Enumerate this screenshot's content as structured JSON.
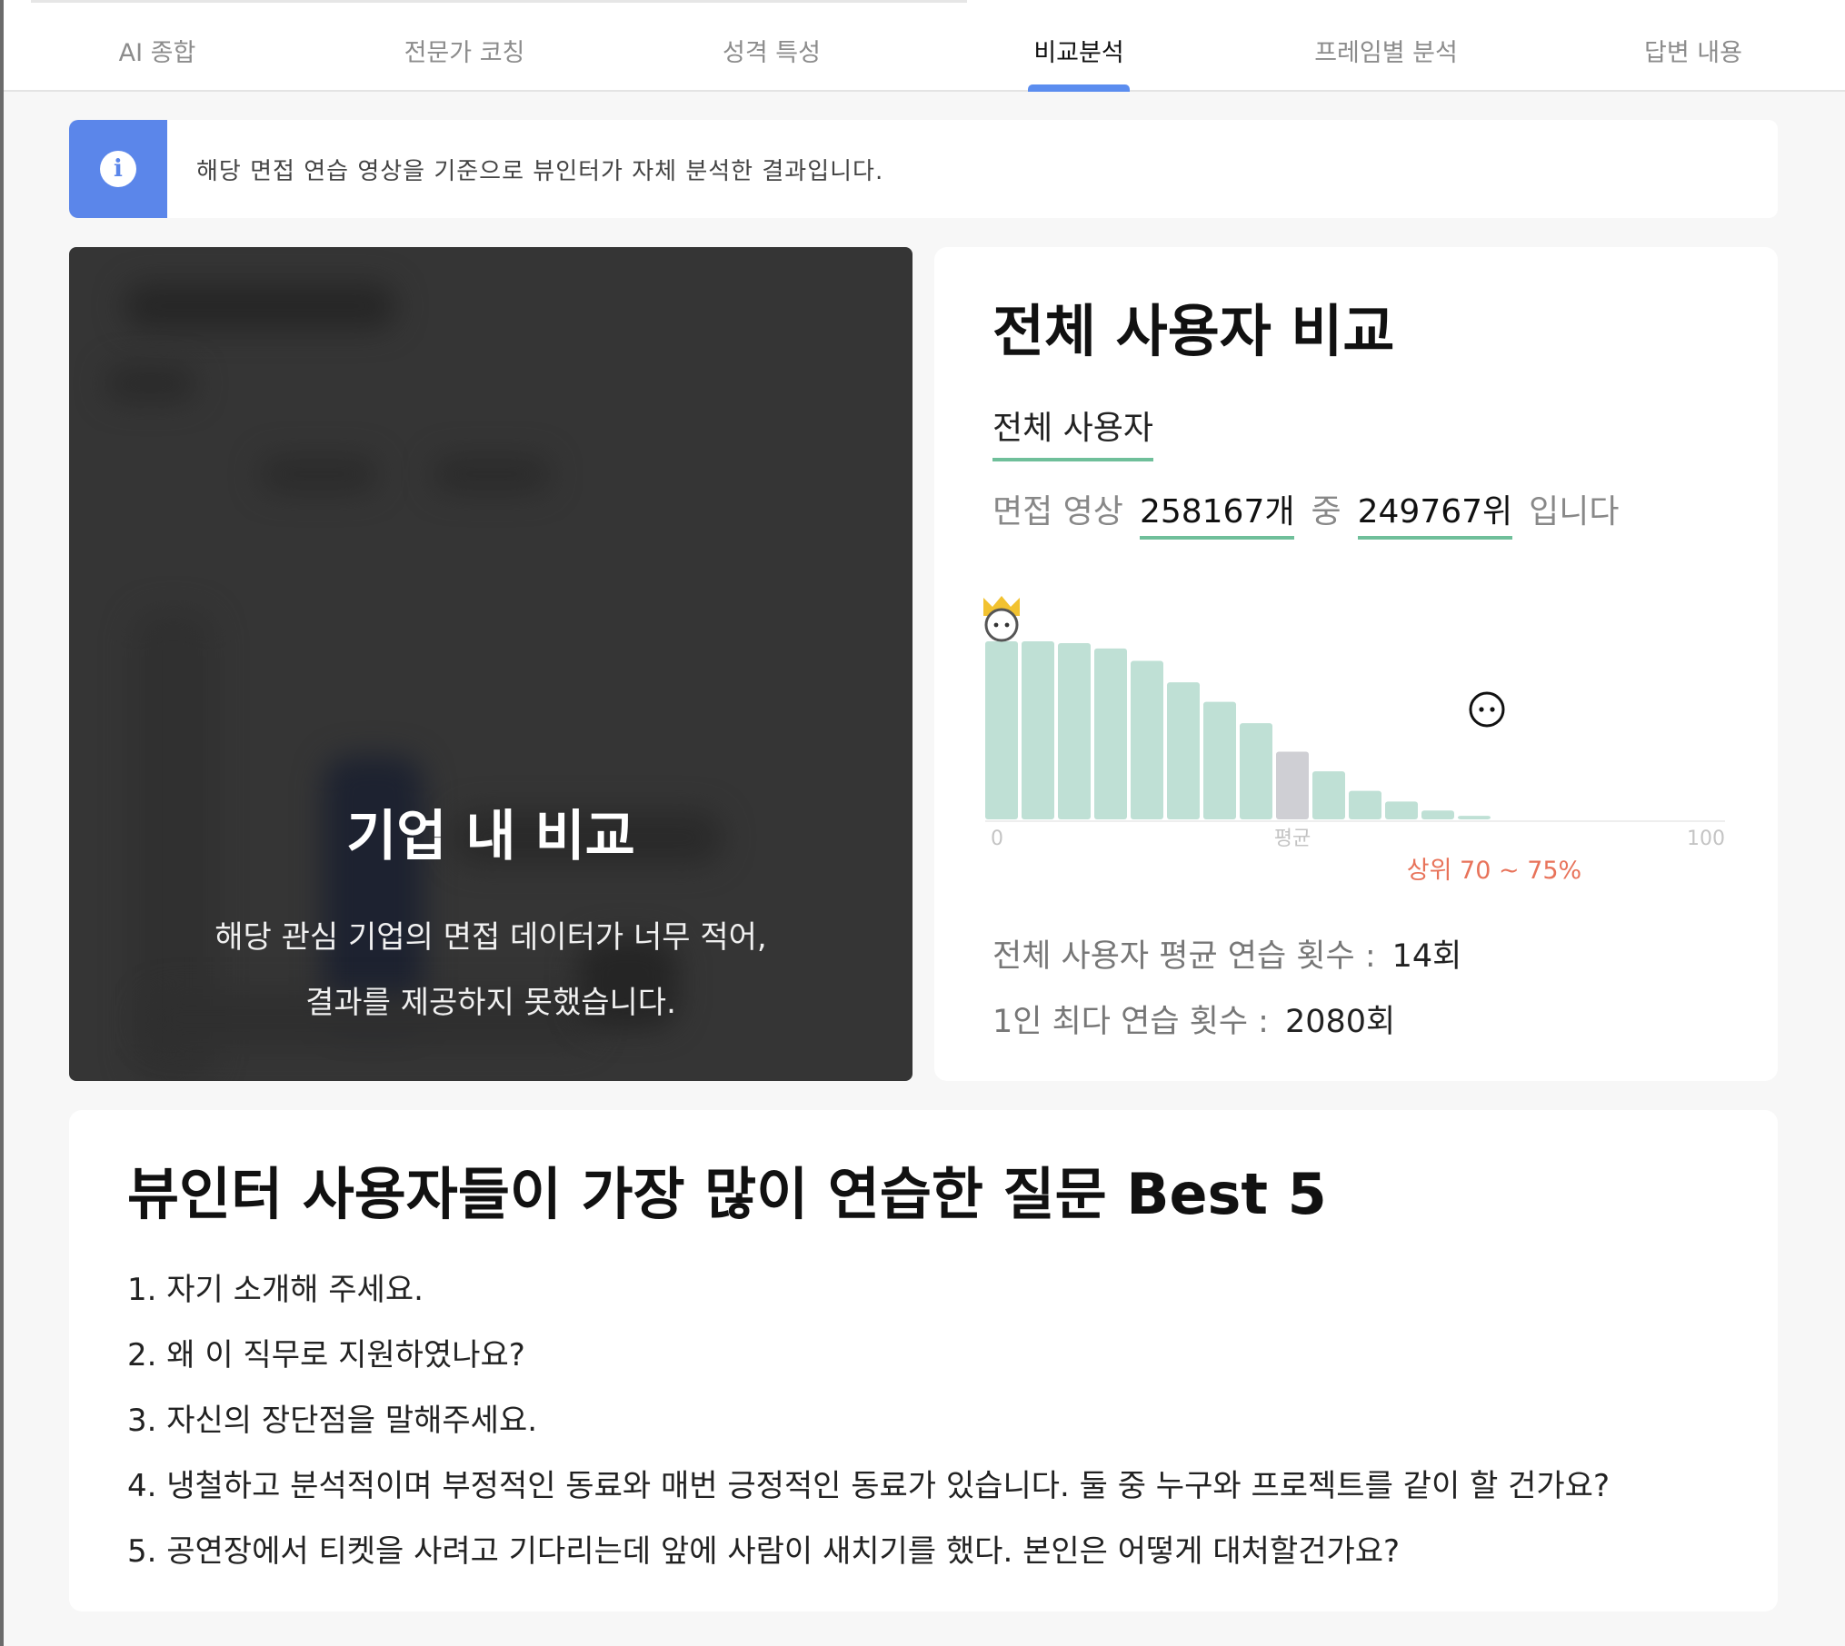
{
  "tabs": [
    {
      "label": "AI 종합",
      "active": false
    },
    {
      "label": "전문가 코칭",
      "active": false
    },
    {
      "label": "성격 특성",
      "active": false
    },
    {
      "label": "비교분석",
      "active": true
    },
    {
      "label": "프레임별 분석",
      "active": false
    },
    {
      "label": "답변 내용",
      "active": false
    }
  ],
  "info": {
    "icon": "info-icon",
    "text": "해당 면접 연습 영상을 기준으로 뷰인터가 자체 분석한 결과입니다."
  },
  "company": {
    "title": "기업 내 비교",
    "message_line1": "해당 관심 기업의 면접 데이터가 너무 적어,",
    "message_line2": "결과를 제공하지 못했습니다."
  },
  "overall": {
    "title": "전체 사용자 비교",
    "subtitle": "전체 사용자",
    "summary": {
      "prefix": "면접 영상",
      "total": "258167개",
      "middle": "중",
      "rank": "249767위",
      "suffix": "입니다"
    },
    "stats": [
      {
        "label": "전체 사용자 평균 연습 횟수 :",
        "value": "14회"
      },
      {
        "label": "1인 최다 연습 횟수 :",
        "value": "2080회"
      }
    ]
  },
  "chart_data": {
    "type": "bar",
    "values": [
      100,
      100,
      99,
      96,
      89,
      77,
      66,
      54,
      38,
      27,
      16,
      10,
      5,
      2
    ],
    "highlight_index": 8,
    "bar_color": "#bfe0d5",
    "highlight_color": "#cfcfd4",
    "x_ticks": [
      "0",
      "평균",
      "100"
    ],
    "rank_label": "상위 70 ~ 75%",
    "rank_color": "#e8735a",
    "user_marker_index": 14,
    "top_marker_index": 0
  },
  "questions": {
    "title": "뷰인터 사용자들이 가장 많이 연습한 질문 Best 5",
    "items": [
      "1. 자기 소개해 주세요.",
      "2. 왜 이 직무로 지원하였나요?",
      "3. 자신의 장단점을 말해주세요.",
      "4. 냉철하고 분석적이며 부정적인 동료와 매번 긍정적인 동료가 있습니다. 둘 중 누구와 프로젝트를 같이 할 건가요?",
      "5. 공연장에서 티켓을 사려고 기다리는데 앞에 사람이 새치기를 했다. 본인은 어떻게 대처할건가요?"
    ]
  }
}
